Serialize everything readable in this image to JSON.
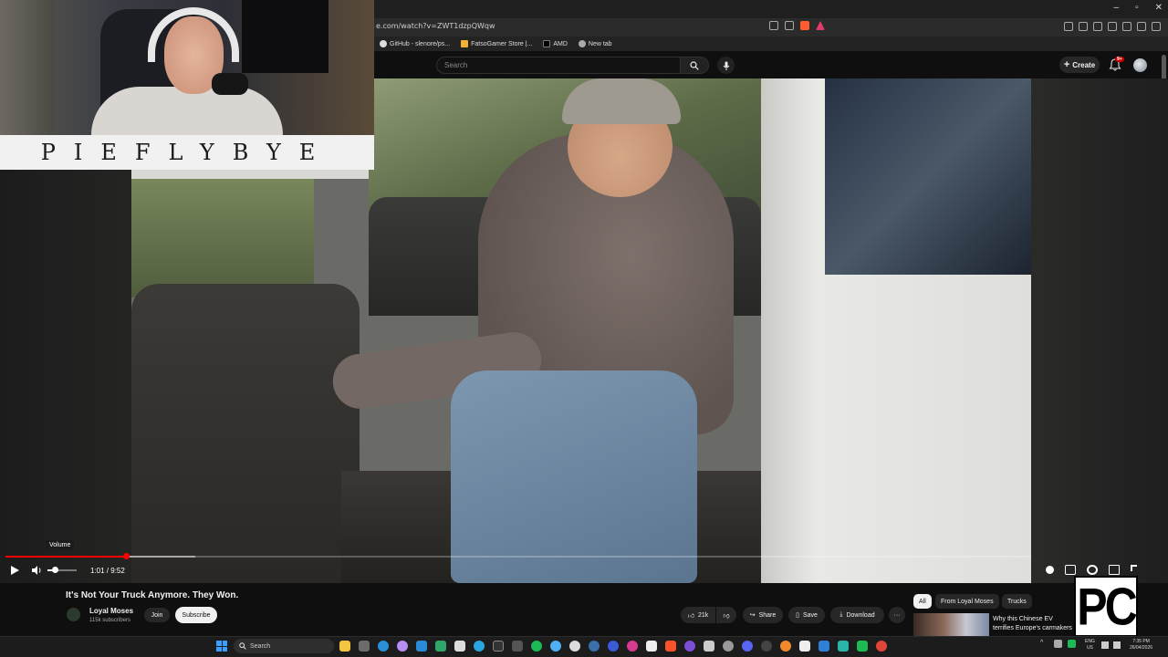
{
  "window": {
    "minimize": "–",
    "maximize": "▫",
    "close": "✕"
  },
  "browser": {
    "url": "e.com/watch?v=ZWT1dzpQWqw",
    "bookmarks": [
      {
        "label": "GitHub - slenore/ps...",
        "icon": "github-icon"
      },
      {
        "label": "FatsoGamer Store |...",
        "icon": "store-icon"
      },
      {
        "label": "AMD",
        "icon": "amd-icon"
      },
      {
        "label": "New tab",
        "icon": "new-tab-icon"
      }
    ]
  },
  "youtube_header": {
    "search_placeholder": "Search",
    "create_label": "Create",
    "notification_count": "9+"
  },
  "webcam_banner": "PIEFLYBYE",
  "player": {
    "volume_tooltip": "Volume",
    "current_time": "1:01",
    "duration": "9:52",
    "time_display": "1:01 / 9:52",
    "played_fraction": 0.103
  },
  "video": {
    "title": "It's Not Your Truck Anymore. They Won.",
    "channel_name": "Loyal Moses",
    "subscribers": "115k subscribers",
    "join_label": "Join",
    "subscribe_label": "Subscribe",
    "likes": "21k",
    "share_label": "Share",
    "save_label": "Save",
    "download_label": "Download",
    "more_label": "···"
  },
  "recommendations": {
    "chips": [
      "All",
      "From Loyal Moses",
      "Trucks"
    ],
    "first_video_title": "Why this Chinese EV terrifies Europe's carmakers"
  },
  "overlay_logo": "PC",
  "taskbar": {
    "search_placeholder": "Search",
    "language_line1": "ENG",
    "language_line2": "US",
    "time": "7:35 PM",
    "date": "26/04/2026"
  },
  "colors": {
    "youtube_red": "#ff0000",
    "background": "#0f0f0f",
    "accent_blue": "#3aa0ff"
  }
}
